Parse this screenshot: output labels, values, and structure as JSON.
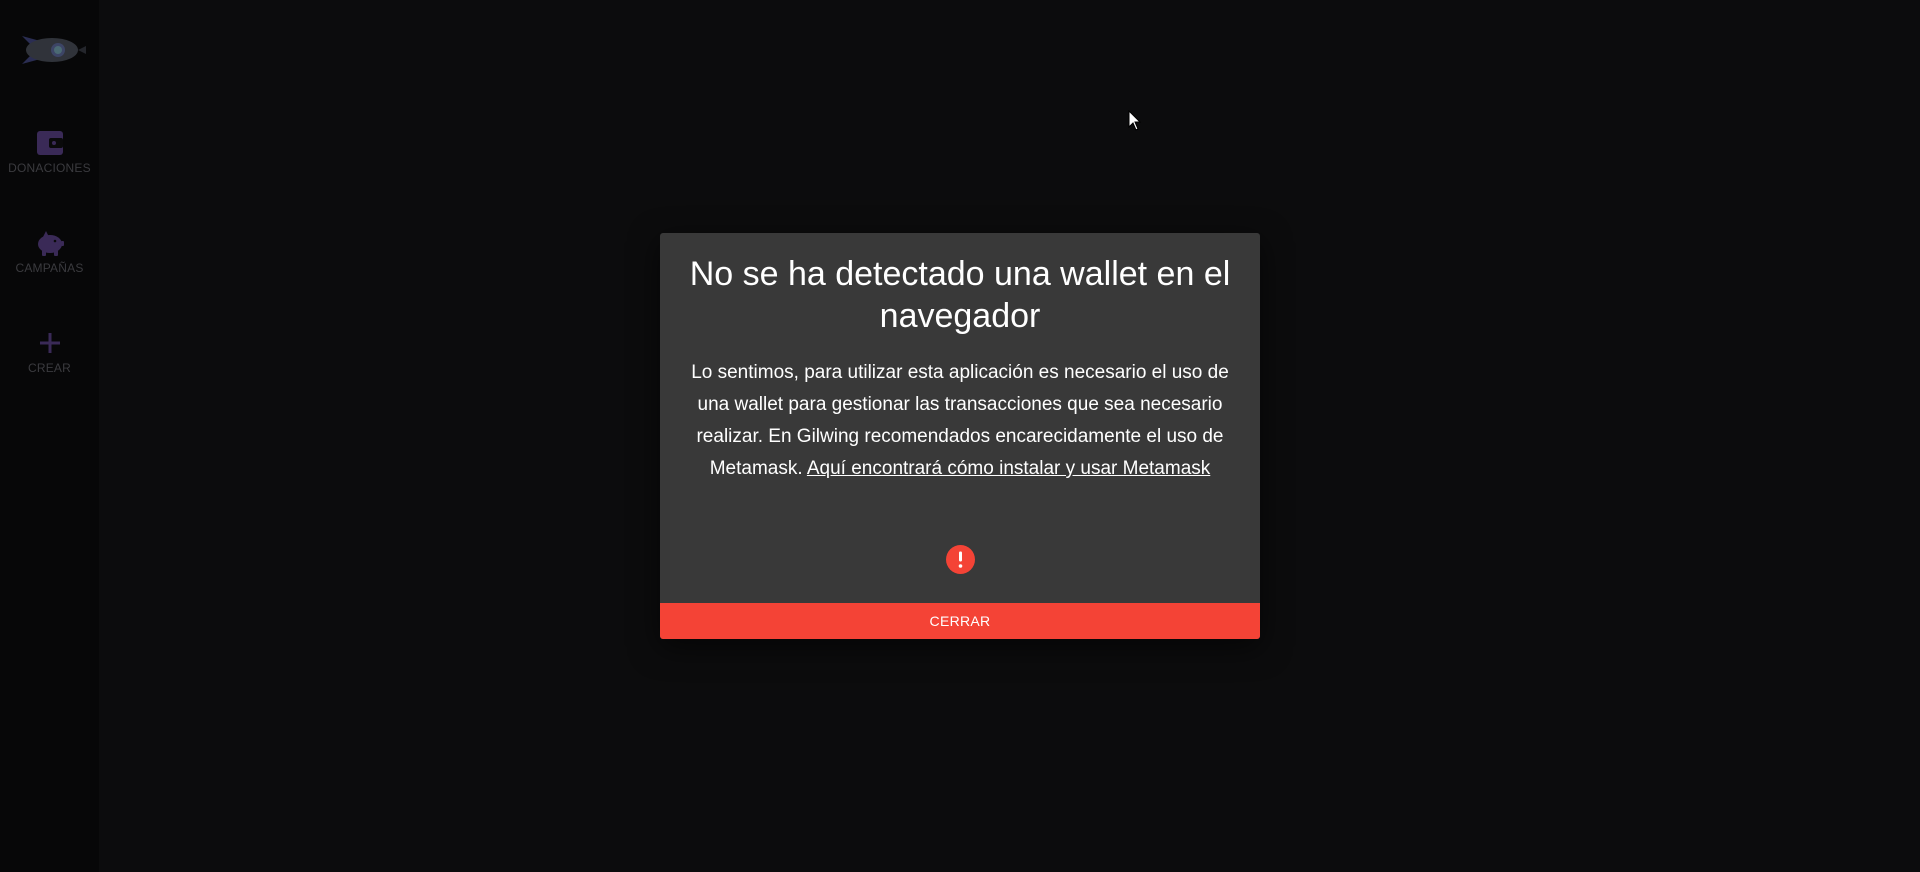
{
  "sidebar": {
    "logo_icon": "rocket-icon",
    "items": [
      {
        "label": "DONACIONES",
        "icon": "wallet-icon"
      },
      {
        "label": "CAMPAÑAS",
        "icon": "piggy-bank-icon"
      },
      {
        "label": "CREAR",
        "icon": "plus-icon"
      }
    ]
  },
  "modal": {
    "title": "No se ha detectado una wallet en el navegador",
    "body": "Lo sentimos, para utilizar esta aplicación es necesario el uso de una wallet para gestionar las transacciones que sea necesario realizar. En Gilwing recomendados encarecidamente el uso de Metamask. ",
    "link_text": "Aquí encontrará cómo instalar y usar Metamask",
    "alert_icon": "exclamation-circle-icon",
    "close_label": "CERRAR"
  },
  "colors": {
    "accent": "#f44336",
    "modal_bg": "#393939",
    "sidebar_icon": "#3a2a57",
    "background": "#0c0c0d"
  }
}
